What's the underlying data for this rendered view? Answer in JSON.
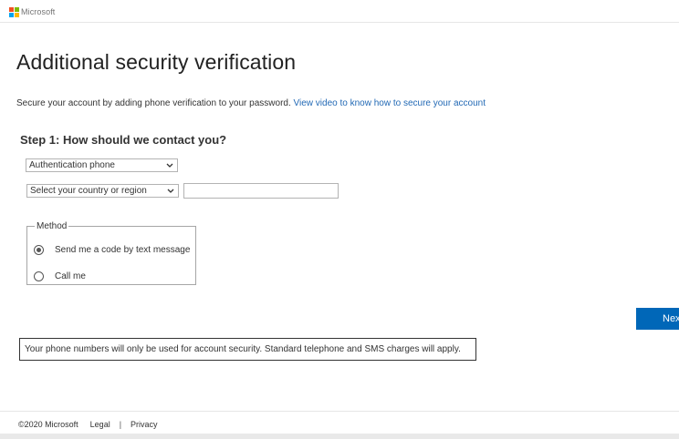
{
  "brand": {
    "name": "Microsoft",
    "logo_colors": [
      "#f25022",
      "#7fba00",
      "#00a4ef",
      "#ffb900"
    ]
  },
  "page": {
    "title": "Additional security verification",
    "intro_text": "Secure your account by adding phone verification to your password.",
    "intro_link": "View video to know how to secure your account"
  },
  "step1": {
    "heading": "Step 1: How should we contact you?",
    "contact_method_selected": "Authentication phone",
    "country_selected": "Select your country or region",
    "phone_value": ""
  },
  "method": {
    "legend": "Method",
    "options": [
      {
        "label": "Send me a code by text message",
        "checked": true
      },
      {
        "label": "Call me",
        "checked": false
      }
    ]
  },
  "actions": {
    "next_label": "Next"
  },
  "notice": "Your phone numbers will only be used for account security. Standard telephone and SMS charges will apply.",
  "footer": {
    "copyright": "©2020 Microsoft",
    "legal": "Legal",
    "separator": "|",
    "privacy": "Privacy"
  },
  "colors": {
    "accent": "#0067b8",
    "link": "#2269b5"
  }
}
